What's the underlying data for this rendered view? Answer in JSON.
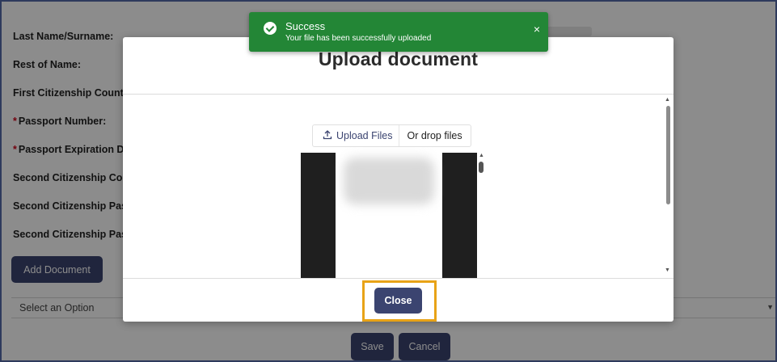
{
  "form": {
    "fields": [
      {
        "label": "Last Name/Surname:",
        "required": false
      },
      {
        "label": "Rest of Name:",
        "required": false
      },
      {
        "label": "First Citizenship Countr",
        "required": false
      },
      {
        "label": "Passport Number:",
        "required": true
      },
      {
        "label": "Passport Expiration Da",
        "required": true
      },
      {
        "label": "Second Citizenship Cou",
        "required": false
      },
      {
        "label": "Second Citizenship Pas",
        "required": false
      },
      {
        "label": "Second Citizenship Pas",
        "required": false
      }
    ],
    "required_marker": "*",
    "add_document_label": "Add Document",
    "select_placeholder": "Select an Option",
    "save_label": "Save",
    "cancel_label": "Cancel"
  },
  "modal": {
    "title": "Upload document",
    "upload_files_label": "Upload Files",
    "drop_files_label": "Or drop files",
    "close_label": "Close"
  },
  "toast": {
    "title": "Success",
    "message": "Your file has been successfully uploaded",
    "close_glyph": "×"
  },
  "colors": {
    "primary": "#3b4470",
    "success": "#238636",
    "highlight": "#e8a317",
    "required": "#d0021b"
  },
  "icons": {
    "upload": "upload-icon",
    "success": "check-circle-icon",
    "close": "close-icon"
  }
}
